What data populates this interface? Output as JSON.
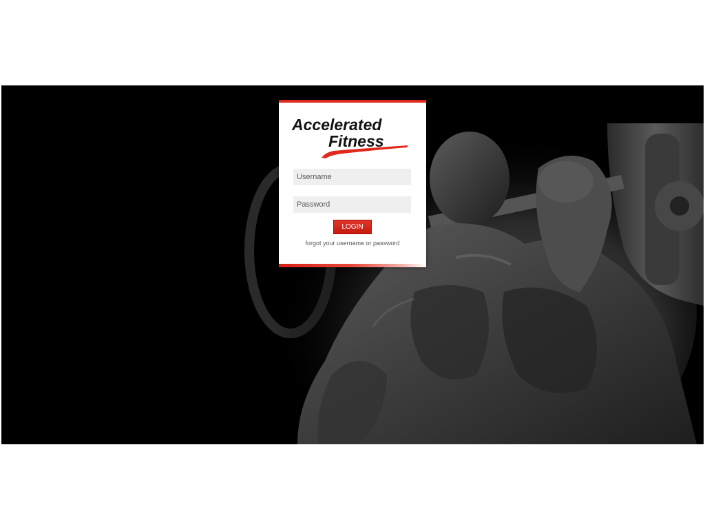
{
  "brand": {
    "name_line1": "Accelerated",
    "name_line2": "Fitness",
    "logo_text_color": "#111111",
    "accent_color": "#e0291d"
  },
  "background": {
    "description_icon": "bodybuilder-with-barbell-image",
    "backdrop_color": "#000000"
  },
  "login_form": {
    "username_placeholder": "Username",
    "password_placeholder": "Password",
    "username_value": "",
    "password_value": "",
    "login_button_label": "LOGIN",
    "forgot_link_label": "forgot your username or password"
  }
}
